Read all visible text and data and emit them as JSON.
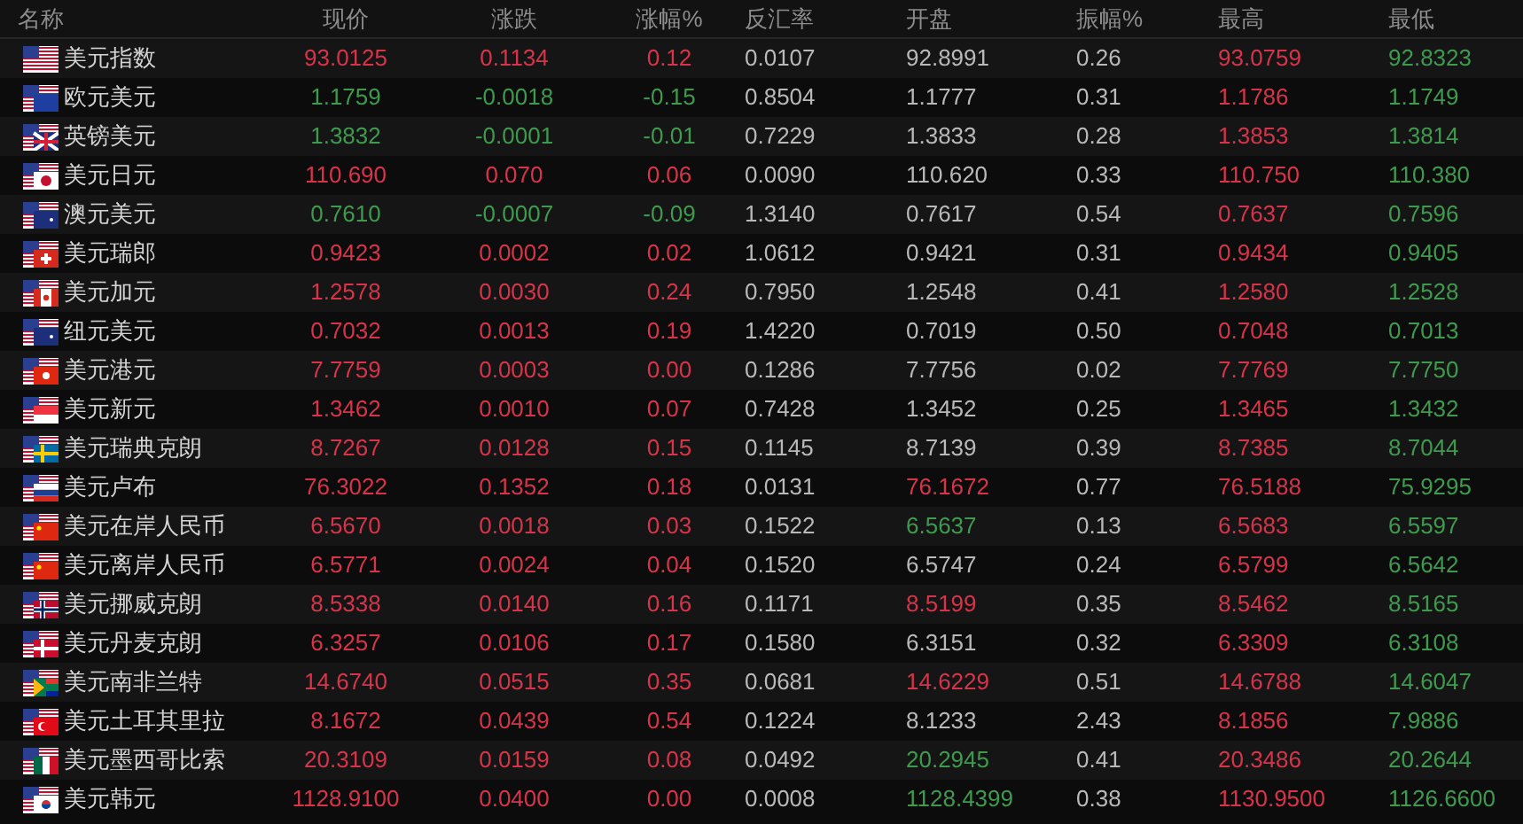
{
  "table": {
    "columns": [
      "名称",
      "现价",
      "涨跌",
      "涨幅%",
      "反汇率",
      "开盘",
      "振幅%",
      "最高",
      "最低"
    ],
    "rows": [
      {
        "kind": "us",
        "cells": [
          {
            "text": "美元指数"
          },
          {
            "text": "93.0125",
            "color": "#d7344a"
          },
          {
            "text": "0.1134",
            "color": "#d7344a"
          },
          {
            "text": "0.12",
            "color": "#d7344a"
          },
          {
            "text": "0.0107",
            "color": "#b9b9b9"
          },
          {
            "text": "92.8991",
            "color": "#b9b9b9"
          },
          {
            "text": "0.26",
            "color": "#b9b9b9"
          },
          {
            "text": "93.0759",
            "color": "#d7344a"
          },
          {
            "text": "92.8323",
            "color": "#3e9b4d"
          }
        ]
      },
      {
        "kind": "eu",
        "cells": [
          {
            "text": "欧元美元"
          },
          {
            "text": "1.1759",
            "color": "#3e9b4d"
          },
          {
            "text": "-0.0018",
            "color": "#3e9b4d"
          },
          {
            "text": "-0.15",
            "color": "#3e9b4d"
          },
          {
            "text": "0.8504",
            "color": "#b9b9b9"
          },
          {
            "text": "1.1777",
            "color": "#b9b9b9"
          },
          {
            "text": "0.31",
            "color": "#b9b9b9"
          },
          {
            "text": "1.1786",
            "color": "#d7344a"
          },
          {
            "text": "1.1749",
            "color": "#3e9b4d"
          }
        ]
      },
      {
        "kind": "gb",
        "cells": [
          {
            "text": "英镑美元"
          },
          {
            "text": "1.3832",
            "color": "#3e9b4d"
          },
          {
            "text": "-0.0001",
            "color": "#3e9b4d"
          },
          {
            "text": "-0.01",
            "color": "#3e9b4d"
          },
          {
            "text": "0.7229",
            "color": "#b9b9b9"
          },
          {
            "text": "1.3833",
            "color": "#b9b9b9"
          },
          {
            "text": "0.28",
            "color": "#b9b9b9"
          },
          {
            "text": "1.3853",
            "color": "#d7344a"
          },
          {
            "text": "1.3814",
            "color": "#3e9b4d"
          }
        ]
      },
      {
        "kind": "jp",
        "cells": [
          {
            "text": "美元日元"
          },
          {
            "text": "110.690",
            "color": "#d7344a"
          },
          {
            "text": "0.070",
            "color": "#d7344a"
          },
          {
            "text": "0.06",
            "color": "#d7344a"
          },
          {
            "text": "0.0090",
            "color": "#b9b9b9"
          },
          {
            "text": "110.620",
            "color": "#b9b9b9"
          },
          {
            "text": "0.33",
            "color": "#b9b9b9"
          },
          {
            "text": "110.750",
            "color": "#d7344a"
          },
          {
            "text": "110.380",
            "color": "#3e9b4d"
          }
        ]
      },
      {
        "kind": "au",
        "cells": [
          {
            "text": "澳元美元"
          },
          {
            "text": "0.7610",
            "color": "#3e9b4d"
          },
          {
            "text": "-0.0007",
            "color": "#3e9b4d"
          },
          {
            "text": "-0.09",
            "color": "#3e9b4d"
          },
          {
            "text": "1.3140",
            "color": "#b9b9b9"
          },
          {
            "text": "0.7617",
            "color": "#b9b9b9"
          },
          {
            "text": "0.54",
            "color": "#b9b9b9"
          },
          {
            "text": "0.7637",
            "color": "#d7344a"
          },
          {
            "text": "0.7596",
            "color": "#3e9b4d"
          }
        ]
      },
      {
        "kind": "ch",
        "cells": [
          {
            "text": "美元瑞郎"
          },
          {
            "text": "0.9423",
            "color": "#d7344a"
          },
          {
            "text": "0.0002",
            "color": "#d7344a"
          },
          {
            "text": "0.02",
            "color": "#d7344a"
          },
          {
            "text": "1.0612",
            "color": "#b9b9b9"
          },
          {
            "text": "0.9421",
            "color": "#b9b9b9"
          },
          {
            "text": "0.31",
            "color": "#b9b9b9"
          },
          {
            "text": "0.9434",
            "color": "#d7344a"
          },
          {
            "text": "0.9405",
            "color": "#3e9b4d"
          }
        ]
      },
      {
        "kind": "ca",
        "cells": [
          {
            "text": "美元加元"
          },
          {
            "text": "1.2578",
            "color": "#d7344a"
          },
          {
            "text": "0.0030",
            "color": "#d7344a"
          },
          {
            "text": "0.24",
            "color": "#d7344a"
          },
          {
            "text": "0.7950",
            "color": "#b9b9b9"
          },
          {
            "text": "1.2548",
            "color": "#b9b9b9"
          },
          {
            "text": "0.41",
            "color": "#b9b9b9"
          },
          {
            "text": "1.2580",
            "color": "#d7344a"
          },
          {
            "text": "1.2528",
            "color": "#3e9b4d"
          }
        ]
      },
      {
        "kind": "nz",
        "cells": [
          {
            "text": "纽元美元"
          },
          {
            "text": "0.7032",
            "color": "#d7344a"
          },
          {
            "text": "0.0013",
            "color": "#d7344a"
          },
          {
            "text": "0.19",
            "color": "#d7344a"
          },
          {
            "text": "1.4220",
            "color": "#b9b9b9"
          },
          {
            "text": "0.7019",
            "color": "#b9b9b9"
          },
          {
            "text": "0.50",
            "color": "#b9b9b9"
          },
          {
            "text": "0.7048",
            "color": "#d7344a"
          },
          {
            "text": "0.7013",
            "color": "#3e9b4d"
          }
        ]
      },
      {
        "kind": "hk",
        "cells": [
          {
            "text": "美元港元"
          },
          {
            "text": "7.7759",
            "color": "#d7344a"
          },
          {
            "text": "0.0003",
            "color": "#d7344a"
          },
          {
            "text": "0.00",
            "color": "#d7344a"
          },
          {
            "text": "0.1286",
            "color": "#b9b9b9"
          },
          {
            "text": "7.7756",
            "color": "#b9b9b9"
          },
          {
            "text": "0.02",
            "color": "#b9b9b9"
          },
          {
            "text": "7.7769",
            "color": "#d7344a"
          },
          {
            "text": "7.7750",
            "color": "#3e9b4d"
          }
        ]
      },
      {
        "kind": "sg",
        "cells": [
          {
            "text": "美元新元"
          },
          {
            "text": "1.3462",
            "color": "#d7344a"
          },
          {
            "text": "0.0010",
            "color": "#d7344a"
          },
          {
            "text": "0.07",
            "color": "#d7344a"
          },
          {
            "text": "0.7428",
            "color": "#b9b9b9"
          },
          {
            "text": "1.3452",
            "color": "#b9b9b9"
          },
          {
            "text": "0.25",
            "color": "#b9b9b9"
          },
          {
            "text": "1.3465",
            "color": "#d7344a"
          },
          {
            "text": "1.3432",
            "color": "#3e9b4d"
          }
        ]
      },
      {
        "kind": "se",
        "cells": [
          {
            "text": "美元瑞典克朗"
          },
          {
            "text": "8.7267",
            "color": "#d7344a"
          },
          {
            "text": "0.0128",
            "color": "#d7344a"
          },
          {
            "text": "0.15",
            "color": "#d7344a"
          },
          {
            "text": "0.1145",
            "color": "#b9b9b9"
          },
          {
            "text": "8.7139",
            "color": "#b9b9b9"
          },
          {
            "text": "0.39",
            "color": "#b9b9b9"
          },
          {
            "text": "8.7385",
            "color": "#d7344a"
          },
          {
            "text": "8.7044",
            "color": "#3e9b4d"
          }
        ]
      },
      {
        "kind": "ru",
        "cells": [
          {
            "text": "美元卢布"
          },
          {
            "text": "76.3022",
            "color": "#d7344a"
          },
          {
            "text": "0.1352",
            "color": "#d7344a"
          },
          {
            "text": "0.18",
            "color": "#d7344a"
          },
          {
            "text": "0.0131",
            "color": "#b9b9b9"
          },
          {
            "text": "76.1672",
            "color": "#d7344a"
          },
          {
            "text": "0.77",
            "color": "#b9b9b9"
          },
          {
            "text": "76.5188",
            "color": "#d7344a"
          },
          {
            "text": "75.9295",
            "color": "#3e9b4d"
          }
        ]
      },
      {
        "kind": "cn",
        "cells": [
          {
            "text": "美元在岸人民币"
          },
          {
            "text": "6.5670",
            "color": "#d7344a"
          },
          {
            "text": "0.0018",
            "color": "#d7344a"
          },
          {
            "text": "0.03",
            "color": "#d7344a"
          },
          {
            "text": "0.1522",
            "color": "#b9b9b9"
          },
          {
            "text": "6.5637",
            "color": "#3e9b4d"
          },
          {
            "text": "0.13",
            "color": "#b9b9b9"
          },
          {
            "text": "6.5683",
            "color": "#d7344a"
          },
          {
            "text": "6.5597",
            "color": "#3e9b4d"
          }
        ]
      },
      {
        "kind": "cn",
        "cells": [
          {
            "text": "美元离岸人民币"
          },
          {
            "text": "6.5771",
            "color": "#d7344a"
          },
          {
            "text": "0.0024",
            "color": "#d7344a"
          },
          {
            "text": "0.04",
            "color": "#d7344a"
          },
          {
            "text": "0.1520",
            "color": "#b9b9b9"
          },
          {
            "text": "6.5747",
            "color": "#b9b9b9"
          },
          {
            "text": "0.24",
            "color": "#b9b9b9"
          },
          {
            "text": "6.5799",
            "color": "#d7344a"
          },
          {
            "text": "6.5642",
            "color": "#3e9b4d"
          }
        ]
      },
      {
        "kind": "no",
        "cells": [
          {
            "text": "美元挪威克朗"
          },
          {
            "text": "8.5338",
            "color": "#d7344a"
          },
          {
            "text": "0.0140",
            "color": "#d7344a"
          },
          {
            "text": "0.16",
            "color": "#d7344a"
          },
          {
            "text": "0.1171",
            "color": "#b9b9b9"
          },
          {
            "text": "8.5199",
            "color": "#d7344a"
          },
          {
            "text": "0.35",
            "color": "#b9b9b9"
          },
          {
            "text": "8.5462",
            "color": "#d7344a"
          },
          {
            "text": "8.5165",
            "color": "#3e9b4d"
          }
        ]
      },
      {
        "kind": "dk",
        "cells": [
          {
            "text": "美元丹麦克朗"
          },
          {
            "text": "6.3257",
            "color": "#d7344a"
          },
          {
            "text": "0.0106",
            "color": "#d7344a"
          },
          {
            "text": "0.17",
            "color": "#d7344a"
          },
          {
            "text": "0.1580",
            "color": "#b9b9b9"
          },
          {
            "text": "6.3151",
            "color": "#b9b9b9"
          },
          {
            "text": "0.32",
            "color": "#b9b9b9"
          },
          {
            "text": "6.3309",
            "color": "#d7344a"
          },
          {
            "text": "6.3108",
            "color": "#3e9b4d"
          }
        ]
      },
      {
        "kind": "za",
        "cells": [
          {
            "text": "美元南非兰特"
          },
          {
            "text": "14.6740",
            "color": "#d7344a"
          },
          {
            "text": "0.0515",
            "color": "#d7344a"
          },
          {
            "text": "0.35",
            "color": "#d7344a"
          },
          {
            "text": "0.0681",
            "color": "#b9b9b9"
          },
          {
            "text": "14.6229",
            "color": "#d7344a"
          },
          {
            "text": "0.51",
            "color": "#b9b9b9"
          },
          {
            "text": "14.6788",
            "color": "#d7344a"
          },
          {
            "text": "14.6047",
            "color": "#3e9b4d"
          }
        ]
      },
      {
        "kind": "tr",
        "cells": [
          {
            "text": "美元土耳其里拉"
          },
          {
            "text": "8.1672",
            "color": "#d7344a"
          },
          {
            "text": "0.0439",
            "color": "#d7344a"
          },
          {
            "text": "0.54",
            "color": "#d7344a"
          },
          {
            "text": "0.1224",
            "color": "#b9b9b9"
          },
          {
            "text": "8.1233",
            "color": "#b9b9b9"
          },
          {
            "text": "2.43",
            "color": "#b9b9b9"
          },
          {
            "text": "8.1856",
            "color": "#d7344a"
          },
          {
            "text": "7.9886",
            "color": "#3e9b4d"
          }
        ]
      },
      {
        "kind": "mx",
        "cells": [
          {
            "text": "美元墨西哥比索"
          },
          {
            "text": "20.3109",
            "color": "#d7344a"
          },
          {
            "text": "0.0159",
            "color": "#d7344a"
          },
          {
            "text": "0.08",
            "color": "#d7344a"
          },
          {
            "text": "0.0492",
            "color": "#b9b9b9"
          },
          {
            "text": "20.2945",
            "color": "#3e9b4d"
          },
          {
            "text": "0.41",
            "color": "#b9b9b9"
          },
          {
            "text": "20.3486",
            "color": "#d7344a"
          },
          {
            "text": "20.2644",
            "color": "#3e9b4d"
          }
        ]
      },
      {
        "kind": "kr",
        "cells": [
          {
            "text": "美元韩元"
          },
          {
            "text": "1128.9100",
            "color": "#d7344a"
          },
          {
            "text": "0.0400",
            "color": "#d7344a"
          },
          {
            "text": "0.00",
            "color": "#d7344a"
          },
          {
            "text": "0.0008",
            "color": "#b9b9b9"
          },
          {
            "text": "1128.4399",
            "color": "#3e9b4d"
          },
          {
            "text": "0.38",
            "color": "#b9b9b9"
          },
          {
            "text": "1130.9500",
            "color": "#d7344a"
          },
          {
            "text": "1126.6600",
            "color": "#3e9b4d"
          }
        ]
      }
    ]
  }
}
